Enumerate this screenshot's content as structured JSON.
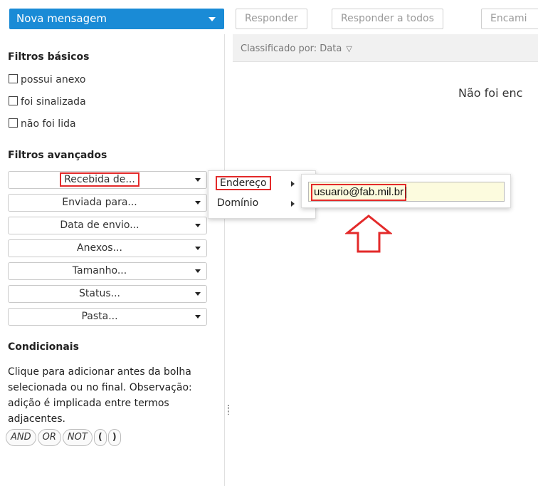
{
  "toolbar": {
    "new_message": "Nova mensagem",
    "reply": "Responder",
    "reply_all": "Responder a todos",
    "forward": "Encami"
  },
  "filters": {
    "basic_title": "Filtros básicos",
    "basic": [
      "possui anexo",
      "foi sinalizada",
      "não foi lida"
    ],
    "advanced_title": "Filtros avançados",
    "advanced": [
      "Recebida de...",
      "Enviada para...",
      "Data de envio...",
      "Anexos...",
      "Tamanho...",
      "Status...",
      "Pasta..."
    ]
  },
  "conditionals": {
    "title": "Condicionais",
    "help": "Clique para adicionar antes da bolha selecionada ou no final. Observação: adição é implicada entre termos adjacentes.",
    "bubbles": [
      "AND",
      "OR",
      "NOT",
      "(",
      ")"
    ]
  },
  "list": {
    "sorted_by": "Classificado por: Data",
    "empty_message": "Não foi enc"
  },
  "submenu": {
    "address": "Endereço",
    "domain": "Domínio"
  },
  "address_input": {
    "value": "usuario@fab.mil.br"
  },
  "colors": {
    "primary": "#1a8bd6",
    "highlight": "#e32a2a",
    "input_bg": "#fcfbde"
  }
}
